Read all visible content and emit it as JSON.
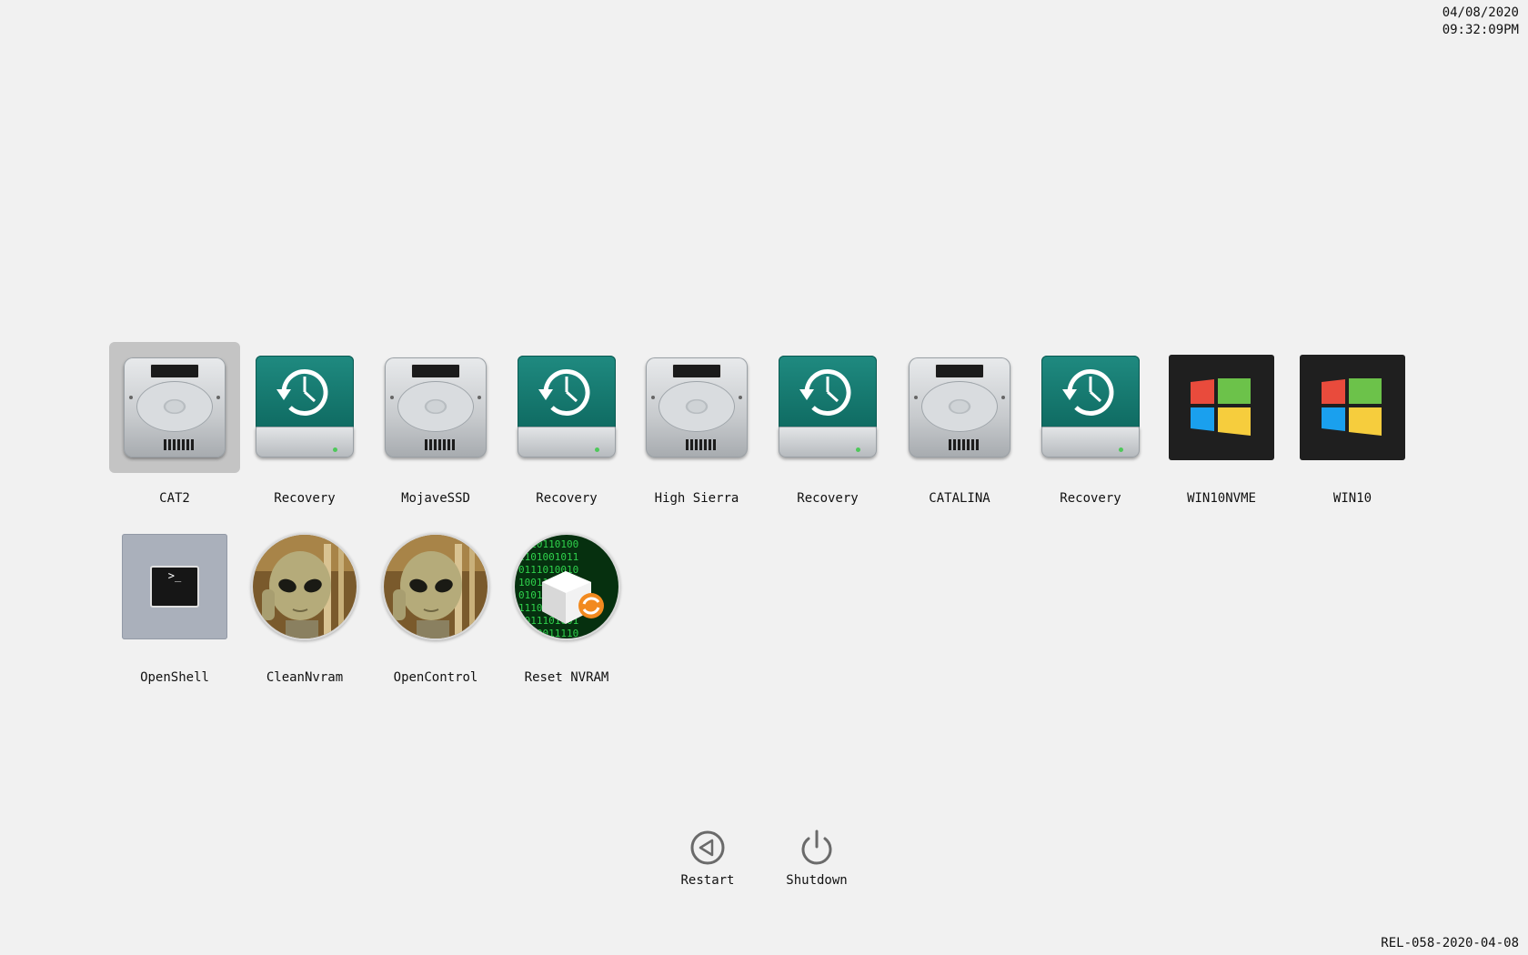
{
  "clock": {
    "date": "04/08/2020",
    "time": "09:32:09PM"
  },
  "version": "REL-058-2020-04-08",
  "entries_row1": [
    {
      "label": "CAT2",
      "kind": "hdd",
      "selected": true
    },
    {
      "label": "Recovery",
      "kind": "recovery"
    },
    {
      "label": "MojaveSSD",
      "kind": "hdd"
    },
    {
      "label": "Recovery",
      "kind": "recovery"
    },
    {
      "label": "High Sierra",
      "kind": "hdd"
    },
    {
      "label": "Recovery",
      "kind": "recovery"
    },
    {
      "label": "CATALINA",
      "kind": "hdd"
    },
    {
      "label": "Recovery",
      "kind": "recovery"
    },
    {
      "label": "WIN10NVME",
      "kind": "windows"
    },
    {
      "label": "WIN10",
      "kind": "windows"
    }
  ],
  "entries_row2": [
    {
      "label": "OpenShell",
      "kind": "shell",
      "prompt": ">_"
    },
    {
      "label": "CleanNvram",
      "kind": "alien"
    },
    {
      "label": "OpenControl",
      "kind": "alien"
    },
    {
      "label": "Reset NVRAM",
      "kind": "nvram"
    }
  ],
  "actions": {
    "restart": "Restart",
    "shutdown": "Shutdown"
  },
  "colors": {
    "background": "#f1f1f1",
    "selection": "#c4c4c4",
    "time_machine_teal": "#13766c",
    "windows_red": "#e94b3c",
    "windows_green": "#6cc24a",
    "windows_blue": "#1aa0ee",
    "windows_yellow": "#f6cd3d"
  }
}
